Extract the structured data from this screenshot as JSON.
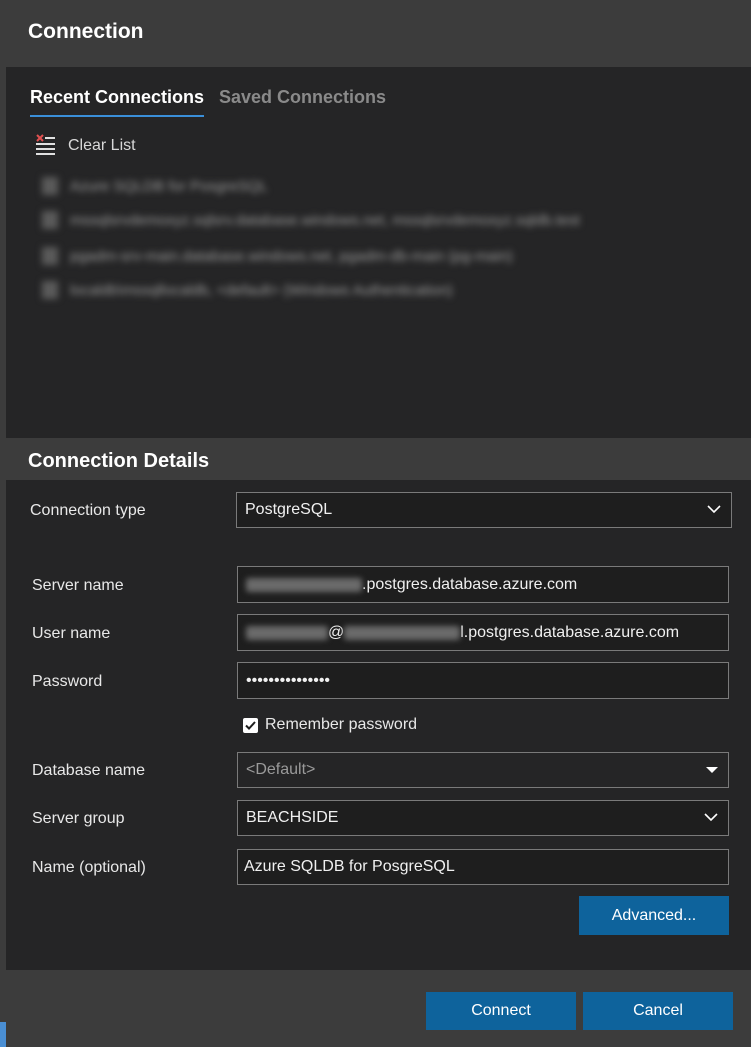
{
  "dialog": {
    "title": "Connection"
  },
  "tabs": [
    {
      "label": "Recent Connections",
      "active": true
    },
    {
      "label": "Saved Connections",
      "active": false
    }
  ],
  "recent": {
    "clear_label": "Clear List",
    "items": [
      {
        "label": "Azure SQLDB for PosgreSQL"
      },
      {
        "label": "mssqlsrvdemoxyz.sqlsrv.database.windows.net, mssqlsrvdemoxyz.sqldb.test"
      },
      {
        "label": "pgadm-srv-main.database.windows.net, pgadm-db-main (pg-main)"
      },
      {
        "label": "localdb\\mssqllocaldb, <default> (Windows Authentication)"
      }
    ]
  },
  "details": {
    "title": "Connection Details",
    "connection_type": {
      "label": "Connection type",
      "value": "PostgreSQL"
    },
    "server_name": {
      "label": "Server name",
      "value": ".postgres.database.azure.com"
    },
    "user_name": {
      "label": "User name",
      "at": "@",
      "value": "l.postgres.database.azure.com"
    },
    "password": {
      "label": "Password",
      "value": "•••••••••••••••"
    },
    "remember": {
      "label": "Remember password",
      "checked": true
    },
    "database": {
      "label": "Database name",
      "placeholder": "<Default>"
    },
    "server_group": {
      "label": "Server group",
      "value": "BEACHSIDE"
    },
    "name": {
      "label": "Name (optional)",
      "value": "Azure SQLDB for PosgreSQL"
    },
    "advanced_label": "Advanced..."
  },
  "footer": {
    "connect_label": "Connect",
    "cancel_label": "Cancel"
  },
  "colors": {
    "accent": "#0e639c",
    "tab_underline": "#3a8fd9",
    "background": "#252526",
    "header": "#3c3c3c"
  }
}
